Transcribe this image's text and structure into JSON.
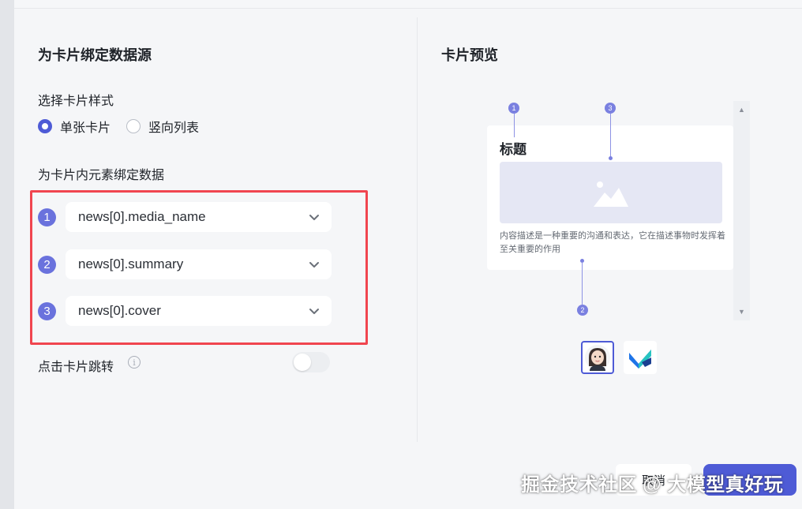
{
  "left": {
    "section_title": "为卡片绑定数据源",
    "style_label": "选择卡片样式",
    "style_options": [
      {
        "label": "单张卡片",
        "checked": true
      },
      {
        "label": "竖向列表",
        "checked": false
      }
    ],
    "bind_label": "为卡片内元素绑定数据",
    "bindings": [
      {
        "index": "1",
        "value": "news[0].media_name"
      },
      {
        "index": "2",
        "value": "news[0].summary"
      },
      {
        "index": "3",
        "value": "news[0].cover"
      }
    ],
    "jump_label": "点击卡片跳转",
    "info_glyph": "i",
    "jump_enabled": false
  },
  "right": {
    "section_title": "卡片预览",
    "card": {
      "title": "标题",
      "description": "内容描述是一种重要的沟通和表达，它在描述事物时发挥着至关重要的作用"
    },
    "markers": [
      "1",
      "3",
      "2"
    ]
  },
  "footer": {
    "cancel_label": "取消"
  },
  "watermark": "掘金技术社区 @ 大模型真好玩",
  "colors": {
    "accent": "#4e5bd6",
    "badge": "#6a72dd",
    "highlight_border": "#f0454f"
  }
}
